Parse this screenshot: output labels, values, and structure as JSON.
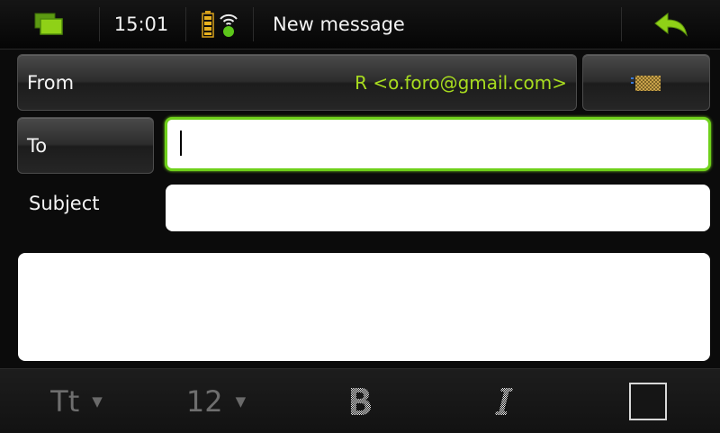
{
  "status_bar": {
    "clock": "15:01",
    "title": "New message",
    "accent_color": "#8fd117"
  },
  "form": {
    "from_label": "From",
    "from_value": "R <o.foro@gmail.com>",
    "to_label": "To",
    "to_value": "",
    "subject_label": "Subject",
    "subject_value": "",
    "body_value": ""
  },
  "toolbar": {
    "font_label": "Tt",
    "font_size": "12",
    "dropdown_glyph": "▼",
    "bold_icon": "bold-icon",
    "italic_icon": "italic-icon",
    "text_color": "#151515"
  }
}
